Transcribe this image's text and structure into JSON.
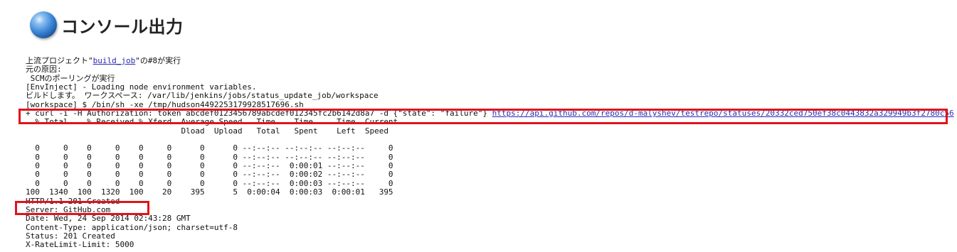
{
  "header": {
    "title": "コンソール出力",
    "icon": "blue-orb-icon"
  },
  "console": {
    "upstream_prefix": "上流プロジェクト\"",
    "upstream_link": "build_job",
    "upstream_suffix": "\"の#8が実行",
    "lines_before_cmd": [
      "元の原因:",
      " SCMのポーリングが実行",
      "[EnvInject] - Loading node environment variables.",
      "ビルドします。 ワークスペース: /var/lib/jenkins/jobs/status_update_job/workspace",
      "[workspace] $ /bin/sh -xe /tmp/hudson4492253179928517696.sh"
    ],
    "cmd_prefix": "+ curl -i -H Authorization: token abcdef0123456789abcdef012345fc2b6142d8a7 -d {\"state\": \"failure\"} ",
    "cmd_url": "https://api.github.com/repos/d-malyshev/testrepo/statuses/20332ced750ef38c0443832a329949b3f2780c56",
    "progress_header": [
      "  % Total    % Received % Xferd  Average Speed   Time    Time     Time  Current",
      "                                 Dload  Upload   Total   Spent    Left  Speed"
    ],
    "progress_rows": [
      "",
      "  0     0    0     0    0     0      0      0 --:--:-- --:--:-- --:--:--     0",
      "  0     0    0     0    0     0      0      0 --:--:-- --:--:-- --:--:--     0",
      "  0     0    0     0    0     0      0      0 --:--:--  0:00:01 --:--:--     0",
      "  0     0    0     0    0     0      0      0 --:--:--  0:00:02 --:--:--     0",
      "  0     0    0     0    0     0      0      0 --:--:--  0:00:03 --:--:--     0",
      "100  1340  100  1320  100    20    395      5  0:00:04  0:00:03  0:00:01   395"
    ],
    "response_lines": [
      "HTTP/1.1 201 Created",
      "Server: GitHub.com",
      "Date: Wed, 24 Sep 2014 02:43:28 GMT",
      "Content-Type: application/json; charset=utf-8",
      "Status: 201 Created",
      "X-RateLimit-Limit: 5000"
    ]
  },
  "highlight_color": "#e0141c"
}
